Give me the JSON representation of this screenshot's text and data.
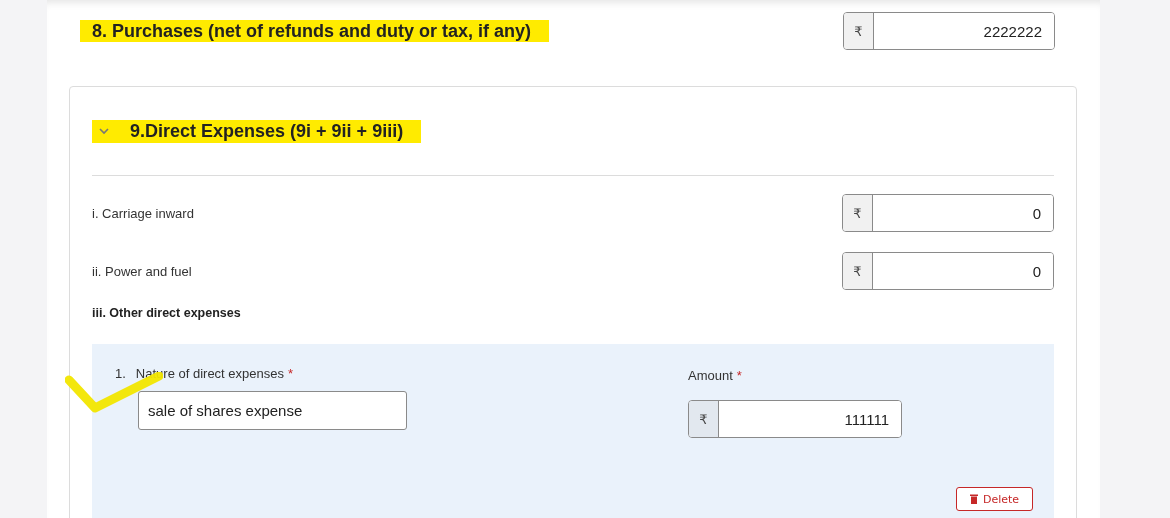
{
  "purchases": {
    "label": "8. Purchases (net of refunds and duty or tax, if any)",
    "highlighted": true,
    "currency": "₹",
    "value": "2222222"
  },
  "direct_expenses": {
    "title": "9.Direct Expenses (9i + 9ii + 9iii)",
    "expanded": true,
    "highlighted": true,
    "rows": [
      {
        "label": "i. Carriage inward",
        "currency": "₹",
        "value": "0"
      },
      {
        "label": "ii. Power and fuel",
        "currency": "₹",
        "value": "0"
      }
    ],
    "other": {
      "label": "iii. Other direct expenses",
      "entries": [
        {
          "number": "1.",
          "check_mark": true,
          "nature_label": "Nature of direct expenses",
          "nature_required": "*",
          "nature_value": "sale of shares expense",
          "amount_label": "Amount",
          "amount_required": "*",
          "currency": "₹",
          "amount_value": "111111",
          "delete_button": "Delete"
        }
      ]
    }
  }
}
